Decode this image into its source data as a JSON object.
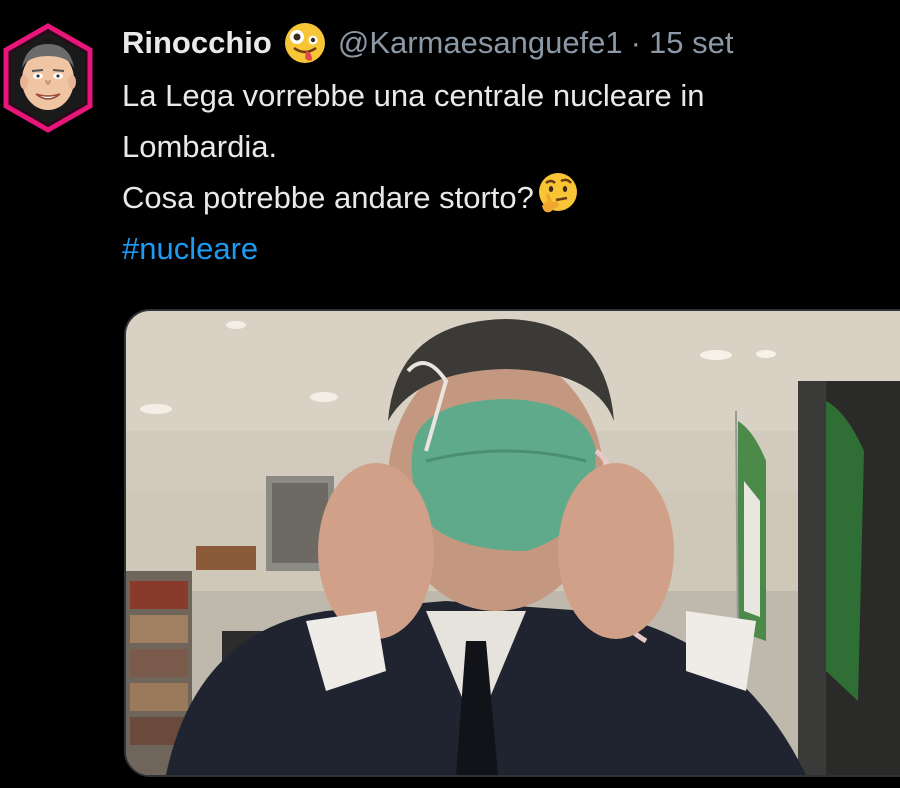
{
  "tweet": {
    "author_name": "Rinocchio",
    "author_emoji_icon": "zany-face-icon",
    "handle": "@Karmaesanguefe1",
    "separator": "·",
    "date": "15 set",
    "text_line_1": "La Lega vorrebbe una centrale nucleare in",
    "text_line_2": "Lombardia.",
    "text_line_3": "Cosa potrebbe andare storto?",
    "text_emoji_icon": "thinking-face-icon",
    "hashtag": "#nucleare",
    "media_description_icon": "photo-man-adjusting-mask"
  },
  "colors": {
    "background": "#000000",
    "text": "#e7e9ea",
    "secondary": "#8b98a5",
    "link": "#1d9bf0",
    "avatar_ring": "#e8157a"
  }
}
